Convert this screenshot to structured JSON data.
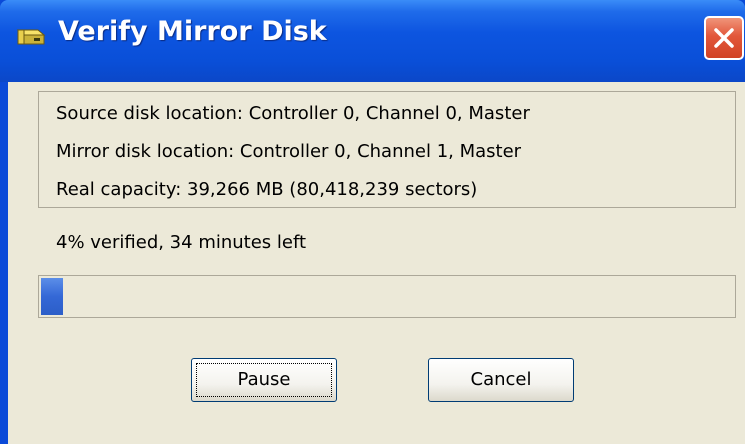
{
  "window": {
    "title": "Verify Mirror Disk",
    "icon": "disk-drive-icon",
    "close_icon": "close-icon",
    "accent_color": "#0a4ad8",
    "close_color": "#e2573b"
  },
  "info": {
    "source": "Source disk location: Controller 0, Channel 0, Master",
    "mirror": "Mirror disk location: Controller 0, Channel 1, Master",
    "capacity": "Real capacity: 39,266 MB (80,418,239 sectors)"
  },
  "status": {
    "text": "4% verified, 34 minutes left",
    "progress_fraction": 0.04,
    "progress_color": "#3468d6"
  },
  "buttons": {
    "pause": "Pause",
    "cancel": "Cancel"
  }
}
